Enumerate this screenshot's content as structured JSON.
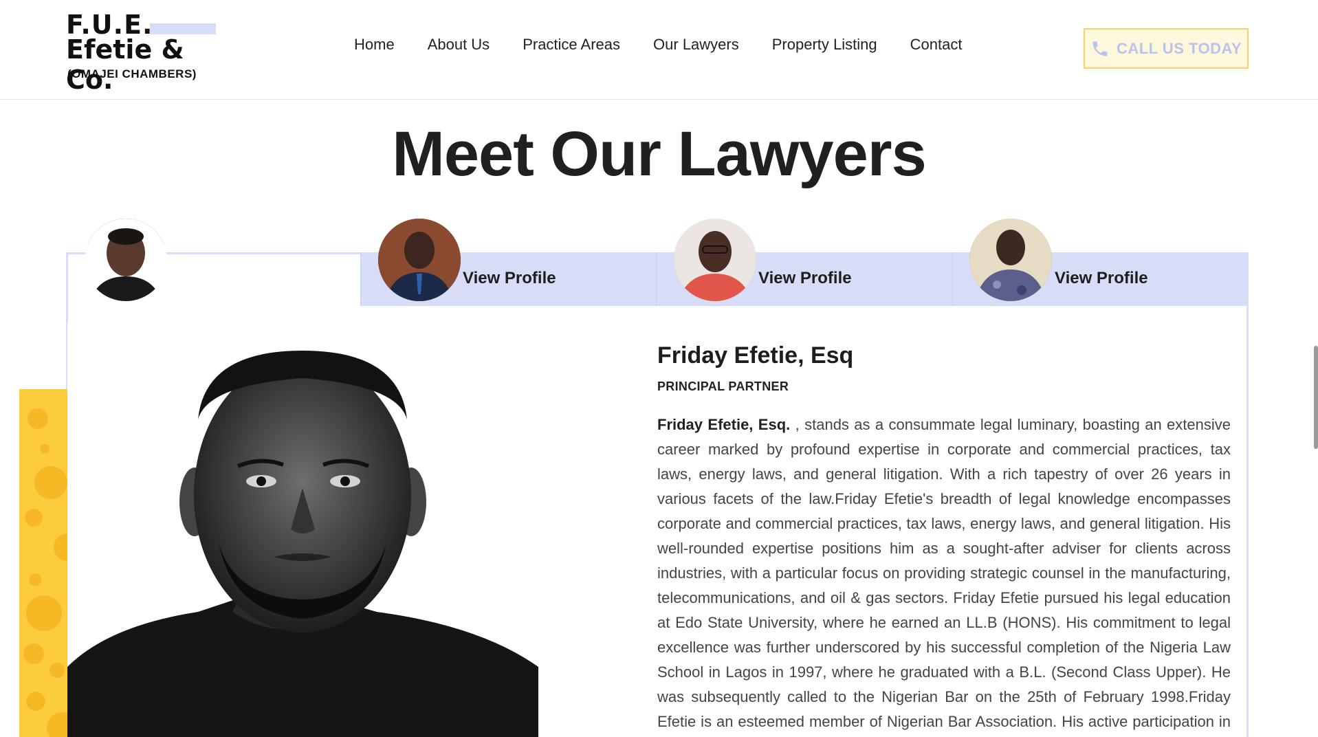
{
  "header": {
    "logo": {
      "line1": "F.U.E.",
      "line2": "Efetie & Co.",
      "line3": "(OMAJEI CHAMBERS)"
    },
    "nav": [
      "Home",
      "About Us",
      "Practice Areas",
      "Our Lawyers",
      "Property Listing",
      "Contact"
    ],
    "cta": {
      "label": "CALL US TODAY",
      "icon": "phone-icon",
      "color": "#b9c3ee",
      "border": "#f2d36b",
      "background": "#fdf8dc"
    }
  },
  "page_title": "Meet Our Lawyers",
  "tabs": [
    {
      "label": "",
      "avatar": "avatar-friday-efetie",
      "active": true
    },
    {
      "label": "View Profile",
      "avatar": "avatar-lawyer-2",
      "active": false
    },
    {
      "label": "View Profile",
      "avatar": "avatar-lawyer-3",
      "active": false
    },
    {
      "label": "View Profile",
      "avatar": "avatar-lawyer-4",
      "active": false
    }
  ],
  "profile": {
    "name": "Friday Efetie, Esq",
    "role": "PRINCIPAL PARTNER",
    "bio_lead": "Friday Efetie, Esq.",
    "bio_text": " , stands as a consummate legal luminary, boasting an extensive career marked by profound expertise in corporate and commercial practices, tax laws, energy laws, and general litigation. With a rich tapestry of over 26 years in various facets of the law.Friday Efetie's breadth of legal knowledge encompasses corporate and commercial practices, tax laws, energy laws, and general litigation. His well-rounded expertise positions him as a sought-after adviser for clients across industries, with a particular focus on providing strategic counsel in the manufacturing, telecommunications, and oil & gas sectors. Friday Efetie pursued his legal education at Edo State University, where he earned an LL.B (HONS). His commitment to legal excellence was further underscored by his successful completion of the Nigeria Law School in Lagos in 1997, where he graduated with a B.L. (Second Class Upper). He was subsequently called to the Nigerian Bar on the 25th of February 1998.Friday Efetie is an esteemed member of Nigerian Bar Association. His active participation in this"
  },
  "colors": {
    "tab_inactive": "#d8ddf7",
    "accent_yellow": "#fdcc3e",
    "title": "#221f1f"
  }
}
